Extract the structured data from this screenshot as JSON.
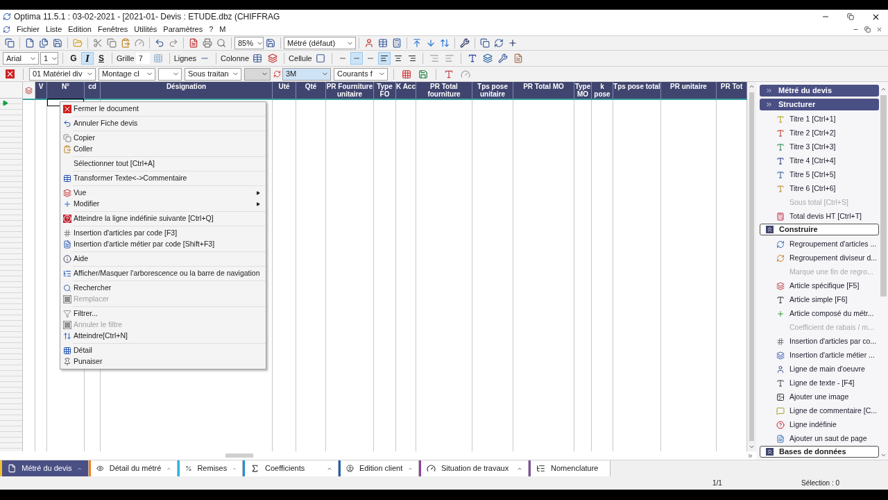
{
  "window": {
    "title": "Optima 11.5.1 : 03-02-2021 - [2021-01- Devis : ETUDE.dbz (CHIFFRAG"
  },
  "menu_bar": [
    "Fichier",
    "Liste",
    "Edition",
    "Fenêtres",
    "Utilités",
    "Paramètres",
    "?",
    "M"
  ],
  "toolbar1": {
    "zoom": "85%",
    "view": "Métré (défaut)"
  },
  "toolbar2": {
    "font": "Arial",
    "size": "1",
    "style_buttons": [
      {
        "label": "G",
        "selected": false
      },
      {
        "label": "I",
        "selected": true
      },
      {
        "label": "S",
        "selected": false
      }
    ],
    "grid_label": "Grille",
    "grid_value": "7",
    "lines_label": "Lignes",
    "column_label": "Colonne",
    "cell_label": "Cellule",
    "border_buttons": [
      {
        "selected": false
      },
      {
        "selected": true
      },
      {
        "selected": false
      }
    ],
    "align_buttons": [
      {
        "selected": true
      },
      {
        "selected": false
      },
      {
        "selected": false
      }
    ]
  },
  "toolbar3": {
    "combos": [
      {
        "value": "01 Matériel div",
        "disabled": false,
        "focused": false
      },
      {
        "value": "Montage cl",
        "disabled": false,
        "focused": false
      },
      {
        "disabled": false,
        "focused": false
      },
      {
        "value": "Sous traitan",
        "disabled": false,
        "focused": false
      },
      {
        "disabled": true,
        "focused": false
      },
      {
        "value": "3M",
        "disabled": false,
        "focused": true
      },
      {
        "value": "Courants f",
        "disabled": false,
        "focused": false
      }
    ]
  },
  "table": {
    "columns": [
      "V",
      "N°",
      "cd",
      "Désignation",
      "Uté",
      "Qté",
      "PR Fourniture unitaire",
      "Type FO",
      "K Acc",
      "PR Total fourniture",
      "Tps pose unitaire",
      "PR Total MO",
      "Type MO",
      "k pose",
      "Tps pose total",
      "PR unitaire",
      "PR Tot"
    ]
  },
  "context_menu": {
    "groups": [
      [
        {
          "label": "Fermer le document",
          "disabled": false,
          "submenu": false
        }
      ],
      [
        {
          "label": "Annuler Fiche devis",
          "disabled": false,
          "submenu": false
        }
      ],
      [
        {
          "label": "Copier",
          "disabled": false,
          "submenu": false
        },
        {
          "label": "Coller",
          "disabled": false,
          "submenu": false
        }
      ],
      [
        {
          "label": "Sélectionner tout [Ctrl+A]",
          "disabled": false,
          "submenu": false
        }
      ],
      [
        {
          "label": "Transformer Texte<->Commentaire",
          "disabled": false,
          "submenu": false
        }
      ],
      [
        {
          "label": "Vue",
          "disabled": false,
          "submenu": true
        },
        {
          "label": "Modifier",
          "disabled": false,
          "submenu": true
        }
      ],
      [
        {
          "label": "Atteindre la ligne indéfinie suivante [Ctrl+Q]",
          "disabled": false,
          "submenu": false
        }
      ],
      [
        {
          "label": "Insertion d'articles par code [F3]",
          "disabled": false,
          "submenu": false
        },
        {
          "label": "Insertion d'article métier par code [Shift+F3]",
          "disabled": false,
          "submenu": false
        }
      ],
      [
        {
          "label": "Aide",
          "disabled": false,
          "submenu": false
        }
      ],
      [
        {
          "label": "Afficher/Masquer l'arborescence ou la barre de navigation",
          "disabled": false,
          "submenu": false
        }
      ],
      [
        {
          "label": "Rechercher",
          "disabled": false,
          "submenu": false
        },
        {
          "label": "Remplacer",
          "disabled": true,
          "submenu": false
        }
      ],
      [
        {
          "label": "Filtrer...",
          "disabled": false,
          "submenu": false
        },
        {
          "label": "Annuler le filtre",
          "disabled": true,
          "submenu": false
        },
        {
          "label": "Atteindre[Ctrl+N]",
          "disabled": false,
          "submenu": false
        }
      ],
      [
        {
          "label": "Détail",
          "disabled": false,
          "submenu": false
        },
        {
          "label": "Punaiser",
          "disabled": false,
          "submenu": false
        }
      ]
    ]
  },
  "side_panel": {
    "sections": [
      {
        "title": "Métré du devis",
        "expanded": false
      },
      {
        "title": "Structurer",
        "expanded": true,
        "items": [
          {
            "label": "Titre 1 [Ctrl+1]",
            "disabled": false
          },
          {
            "label": "Titre 2 [Ctrl+2]",
            "disabled": false
          },
          {
            "label": "Titre 3 [Ctrl+3]",
            "disabled": false
          },
          {
            "label": "Titre 4 [Ctrl+4]",
            "disabled": false
          },
          {
            "label": "Titre 5 [Ctrl+5]",
            "disabled": false
          },
          {
            "label": "Titre 6 [Ctrl+6]",
            "disabled": false
          },
          {
            "label": "Sous total [Ctrl+S]",
            "disabled": true
          },
          {
            "label": "Total devis HT [Ctrl+T]",
            "disabled": false
          }
        ]
      },
      {
        "title": "Construire",
        "expanded": true,
        "items": [
          {
            "label": "Regroupement d'articles ...",
            "disabled": false
          },
          {
            "label": "Regroupement diviseur d...",
            "disabled": false
          },
          {
            "label": "Marque une fin de regro...",
            "disabled": true
          },
          {
            "label": "Article spécifique [F5]",
            "disabled": false
          },
          {
            "label": "Article simple [F6]",
            "disabled": false
          },
          {
            "label": "Article composé du métr...",
            "disabled": false
          },
          {
            "label": "Coefficient de rabais / m...",
            "disabled": true
          },
          {
            "label": "Insertion d'articles par co...",
            "disabled": false
          },
          {
            "label": "Insertion d'article métier ...",
            "disabled": false
          },
          {
            "label": "Ligne de main d'oeuvre",
            "disabled": false
          },
          {
            "label": "Ligne de texte - [F4]",
            "disabled": false
          },
          {
            "label": "Ajouter une image",
            "disabled": false
          },
          {
            "label": "Ligne de commentaire [C...",
            "disabled": false
          },
          {
            "label": "Ligne indéfinie",
            "disabled": false
          },
          {
            "label": "Ajouter un saut de page",
            "disabled": false
          }
        ]
      },
      {
        "title": "Bases de données",
        "expanded": true
      }
    ]
  },
  "bottom_tabs": [
    {
      "label": "Métré du devis",
      "selected": true,
      "color": "#f0c030"
    },
    {
      "label": "Détail du métré",
      "selected": false,
      "color": "#f08020"
    },
    {
      "label": "Remises",
      "selected": false,
      "color": "#30b0e0"
    },
    {
      "label": "Coefficients",
      "selected": false,
      "color": "#2090d0"
    },
    {
      "label": "Edition client",
      "selected": false,
      "color": "#2060b0"
    },
    {
      "label": "Situation de travaux",
      "selected": false,
      "color": "#9040a0"
    },
    {
      "label": "Nomenclature",
      "selected": false,
      "color": "#8050a0"
    }
  ],
  "status_bar": {
    "page": "1/1",
    "selection": "Sélection : 0"
  }
}
